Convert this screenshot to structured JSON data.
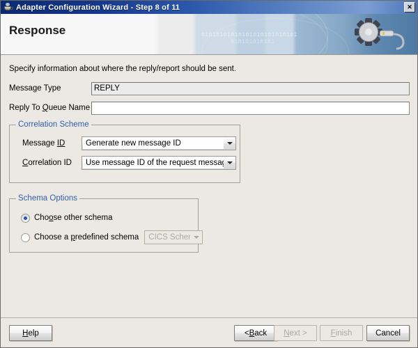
{
  "window": {
    "title": "Adapter Configuration Wizard - Step 8 of 11",
    "icon": "java-coffee-cup-icon",
    "close_label": "✕"
  },
  "banner": {
    "title": "Response",
    "binary_row_1": "01010101010101010101010101",
    "binary_row_2": "010101010101",
    "art": "gear-and-cable-graphic"
  },
  "content": {
    "description": "Specify information about where the reply/report should be sent.",
    "fields": [
      {
        "label_prefix": "Message Type",
        "mnemonic": "",
        "label_suffix": "",
        "value": "REPLY",
        "placeholder": "",
        "readonly": true
      },
      {
        "label_prefix": "Reply To ",
        "mnemonic": "Q",
        "label_suffix": "ueue Name",
        "value": "",
        "placeholder": "",
        "readonly": false
      }
    ],
    "correlation_scheme": {
      "title": "Correlation Scheme",
      "rows": [
        {
          "label_prefix": "Message ",
          "mnemonic": "ID",
          "label_suffix": "",
          "value": "Generate new message ID"
        },
        {
          "label_prefix": "",
          "mnemonic": "C",
          "label_suffix": "orrelation ID",
          "value": "Use message ID of the request message"
        }
      ]
    },
    "schema_options": {
      "title": "Schema Options",
      "radios": [
        {
          "label_prefix": "Cho",
          "mnemonic": "o",
          "label_suffix": "se other schema",
          "selected": true
        },
        {
          "label_prefix": "Choose a ",
          "mnemonic": "p",
          "label_suffix": "redefined schema",
          "selected": false
        }
      ],
      "predefined_schema_value": "CICS Schema",
      "predefined_schema_disabled": true
    }
  },
  "footer": {
    "help": {
      "prefix": "",
      "mnemonic": "H",
      "suffix": "elp",
      "disabled": false
    },
    "back": {
      "prefix": "< ",
      "mnemonic": "B",
      "suffix": "ack",
      "disabled": false
    },
    "next": {
      "prefix": "",
      "mnemonic": "N",
      "suffix": "ext >",
      "disabled": true
    },
    "finish": {
      "prefix": "",
      "mnemonic": "F",
      "suffix": "inish",
      "disabled": true
    },
    "cancel": {
      "prefix": "",
      "mnemonic": "",
      "suffix": "Cancel",
      "disabled": false
    }
  },
  "colors": {
    "titlebar_start": "#0a2a73",
    "titlebar_end": "#4c74b8",
    "group_title": "#2f5fa8",
    "radio_dot": "#2255bb",
    "panel_bg": "#ece9e4"
  }
}
